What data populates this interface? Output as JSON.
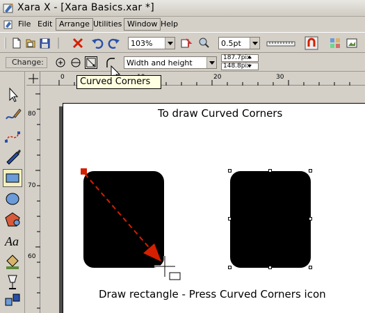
{
  "window": {
    "title": "Xara X - [Xara Basics.xar *]"
  },
  "menu": {
    "items": [
      "File",
      "Edit",
      "Arrange",
      "Utilities",
      "Window",
      "Help"
    ]
  },
  "toolbar": {
    "zoom_value": "103%",
    "line_width_value": "0.5pt"
  },
  "infobar": {
    "change_label": "Change:",
    "size_mode_value": "Width and height",
    "width_value": "187.7pix",
    "height_value": "148.8pix"
  },
  "tooltip": {
    "text": "Curved Corners"
  },
  "rulers": {
    "h_marks": [
      "0",
      "10",
      "20",
      "30"
    ],
    "v_marks": [
      "80",
      "70",
      "60"
    ]
  },
  "canvas": {
    "heading": "To draw Curved Corners",
    "caption": "Draw rectangle - Press Curved Corners icon"
  },
  "colors": {
    "arrow": "#d41f00",
    "tooltip_bg": "#ffffe1",
    "chrome": "#d4d0c8"
  },
  "icons": {
    "toolbar": [
      "new-document-icon",
      "open-icon",
      "save-icon",
      "delete-icon",
      "undo-icon",
      "redo-icon",
      "zoom-to-page-icon",
      "previous-zoom-icon",
      "line-width-ruler-icon",
      "snap-magnet-icon"
    ],
    "shapes": [
      "circle-plus-icon",
      "circle-minus-icon",
      "square-diagonal-icon",
      "curved-corner-icon"
    ],
    "tools": [
      "selector-tool-icon",
      "freehand-tool-icon",
      "bezier-tool-icon",
      "shape-editor-tool-icon",
      "rectangle-tool-icon",
      "ellipse-tool-icon",
      "quickshape-tool-icon",
      "text-tool-icon",
      "fill-tool-icon",
      "transparency-tool-icon",
      "blend-tool-icon"
    ]
  }
}
